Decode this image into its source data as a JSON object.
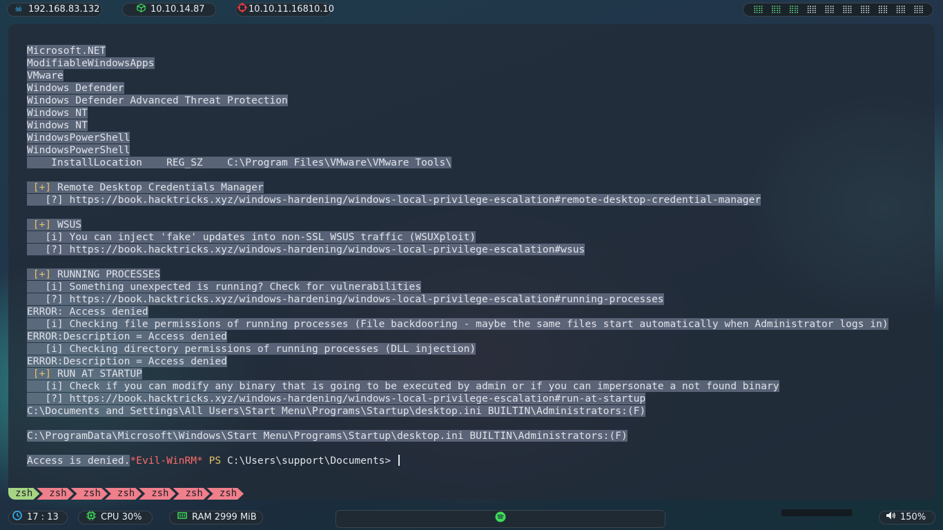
{
  "topbar": {
    "ip_vpn": "192.168.83.132",
    "ip_local": "10.10.14.87",
    "ip_target": "10.10.11.16810.10",
    "workspace_glyphs": [
      "⣿",
      "⣿",
      "⣿",
      "⣿",
      "⣿",
      "⣿",
      "⣿",
      "⣿",
      "⣿",
      "⣿",
      "⣿",
      "⣿",
      "⣿",
      "⣿",
      "⣿",
      "⣿",
      "⣿",
      "⣿",
      "⣿",
      "⣿"
    ],
    "icons": {
      "vpn": "skull-icon",
      "local": "cube-icon",
      "target": "crosshair-icon"
    }
  },
  "terminal": {
    "lines": [
      {
        "text": "Microsoft.NET"
      },
      {
        "text": "ModifiableWindowsApps"
      },
      {
        "text": "VMware"
      },
      {
        "text": "Windows Defender"
      },
      {
        "text": "Windows Defender Advanced Threat Protection"
      },
      {
        "text": "Windows NT"
      },
      {
        "text": "Windows NT"
      },
      {
        "text": "WindowsPowerShell"
      },
      {
        "text": "WindowsPowerShell"
      },
      {
        "text": "    InstallLocation    REG_SZ    C:\\Program Files\\VMware\\VMware Tools\\"
      },
      {
        "text": ""
      },
      {
        "tag": " [+]",
        "text": " Remote Desktop Credentials Manager"
      },
      {
        "text": "   [?] https://book.hacktricks.xyz/windows-hardening/windows-local-privilege-escalation#remote-desktop-credential-manager"
      },
      {
        "text": ""
      },
      {
        "tag": " [+]",
        "text": " WSUS"
      },
      {
        "text": "   [i] You can inject 'fake' updates into non-SSL WSUS traffic (WSUXploit)"
      },
      {
        "text": "   [?] https://book.hacktricks.xyz/windows-hardening/windows-local-privilege-escalation#wsus"
      },
      {
        "text": ""
      },
      {
        "tag": " [+]",
        "text": " RUNNING PROCESSES"
      },
      {
        "text": "   [i] Something unexpected is running? Check for vulnerabilities"
      },
      {
        "text": "   [?] https://book.hacktricks.xyz/windows-hardening/windows-local-privilege-escalation#running-processes"
      },
      {
        "text": "ERROR: Access denied"
      },
      {
        "text": "   [i] Checking file permissions of running processes (File backdooring - maybe the same files start automatically when Administrator logs in)"
      },
      {
        "text": "ERROR:Description = Access denied"
      },
      {
        "text": "   [i] Checking directory permissions of running processes (DLL injection)"
      },
      {
        "text": "ERROR:Description = Access denied"
      },
      {
        "tag": " [+]",
        "text": " RUN AT STARTUP"
      },
      {
        "text": "   [i] Check if you can modify any binary that is going to be executed by admin or if you can impersonate a not found binary"
      },
      {
        "text": "   [?] https://book.hacktricks.xyz/windows-hardening/windows-local-privilege-escalation#run-at-startup"
      },
      {
        "text": "C:\\Documents and Settings\\All Users\\Start Menu\\Programs\\Startup\\desktop.ini BUILTIN\\Administrators:(F)"
      },
      {
        "text": ""
      },
      {
        "text": "C:\\ProgramData\\Microsoft\\Windows\\Start Menu\\Programs\\Startup\\desktop.ini BUILTIN\\Administrators:(F)"
      },
      {
        "text": ""
      }
    ],
    "prompt": {
      "pre": "Access is denied.",
      "shell": "*Evil-WinRM*",
      "ps": "PS",
      "path": "C:\\Users\\support\\Documents>"
    },
    "tabs": [
      "zsh",
      "zsh",
      "zsh",
      "zsh",
      "zsh",
      "zsh",
      "zsh"
    ],
    "active_tab": 0
  },
  "bottombar": {
    "clock": "17 : 13",
    "cpu": "CPU 30%",
    "ram": "RAM 2999 MiB",
    "volume": "150%",
    "icons": {
      "clock": "clock-icon",
      "cpu": "cpu-icon",
      "ram": "ram-icon",
      "media": "spotify-icon",
      "volume": "speaker-icon"
    }
  },
  "colors": {
    "terminal_bg": "#232c38",
    "tag": "#e6c16a",
    "evil_winrm": "#ff6b6b",
    "tab_inactive": "#f07f8c",
    "tab_active": "#a6d483",
    "spotify": "#3fdc5a"
  }
}
